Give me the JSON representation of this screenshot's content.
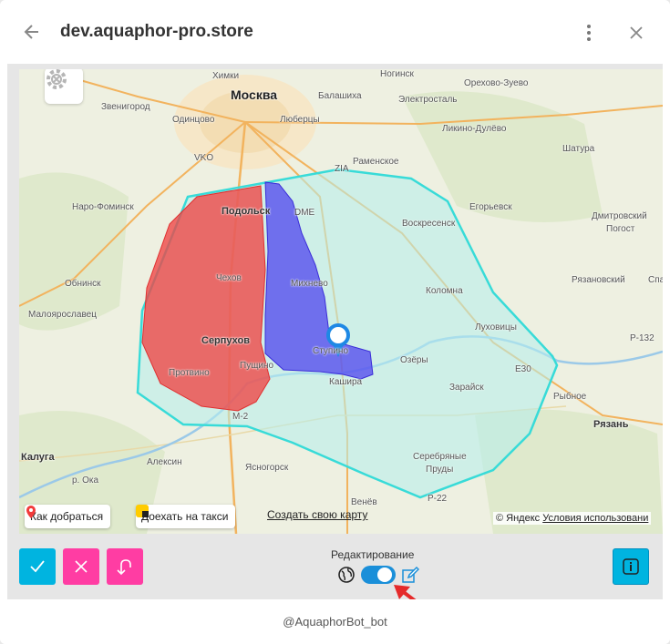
{
  "window": {
    "title": "dev.aquaphor-pro.store",
    "footer_text": "@AquaphorBot_bot"
  },
  "colors": {
    "primary_btn": "#00b4e0",
    "danger_btn": "#ff3da3",
    "toggle_on": "#1a8fd9",
    "zone_red": "#f04444",
    "zone_blue": "#4b3df0",
    "zone_cyan": "#38dbd8"
  },
  "map": {
    "labels": {
      "moskva": "Москва",
      "himki": "Химки",
      "balashiha": "Балашиха",
      "noginsk": "Ногинск",
      "orehovo": "Орехово-Зуево",
      "zvenigorod": "Звенигород",
      "elektrostal": "Электросталь",
      "odintsovo": "Одинцово",
      "lyubertsy": "Люберцы",
      "likino": "Ликино-Дулёво",
      "vko": "VKO",
      "zia": "ZIA",
      "ramenskoe": "Раменское",
      "shatura": "Шатура",
      "naro": "Наро-Фоминск",
      "podolsk": "Подольск",
      "dme": "DME",
      "voskresensk": "Воскресенск",
      "egorievsk": "Егорьевск",
      "dmitrovskiy": "Дмитровский",
      "pogost": "Погост",
      "obninsk": "Обнинск",
      "chehov": "Чехов",
      "mihnevo": "Михнево",
      "kolomna": "Коломна",
      "ryazanovskiy": "Рязановский",
      "spa": "Спа",
      "maloyaroslavets": "Малоярославец",
      "lukhovitsy": "Луховицы",
      "serpuhov": "Серпухов",
      "stupino": "Ступино",
      "ozery": "Озёры",
      "r132": "Р-132",
      "protvino": "Протвино",
      "pushchino": "Пущино",
      "kashira": "Кашира",
      "e30": "E30",
      "zaraysk": "Зарайск",
      "rybnoe": "Рыбное",
      "m2": "М-2",
      "ryazan": "Рязань",
      "kaluga": "Калуга",
      "aleksin": "Алексин",
      "yasnogorsk": "Ясногорск",
      "serebryanye": "Серебряные",
      "prudy": "Пруды",
      "oka": "р. Ока",
      "r22": "Р-22",
      "venev": "Венёв"
    },
    "route_button": "Как добраться",
    "taxi_button": "Доехать на такси",
    "create_map_link": "Создать свою карту",
    "copyright": "© Яндекс",
    "terms_link": "Условия использовани"
  },
  "toolbar": {
    "edit_label": "Редактирование",
    "toggle_on": true
  }
}
